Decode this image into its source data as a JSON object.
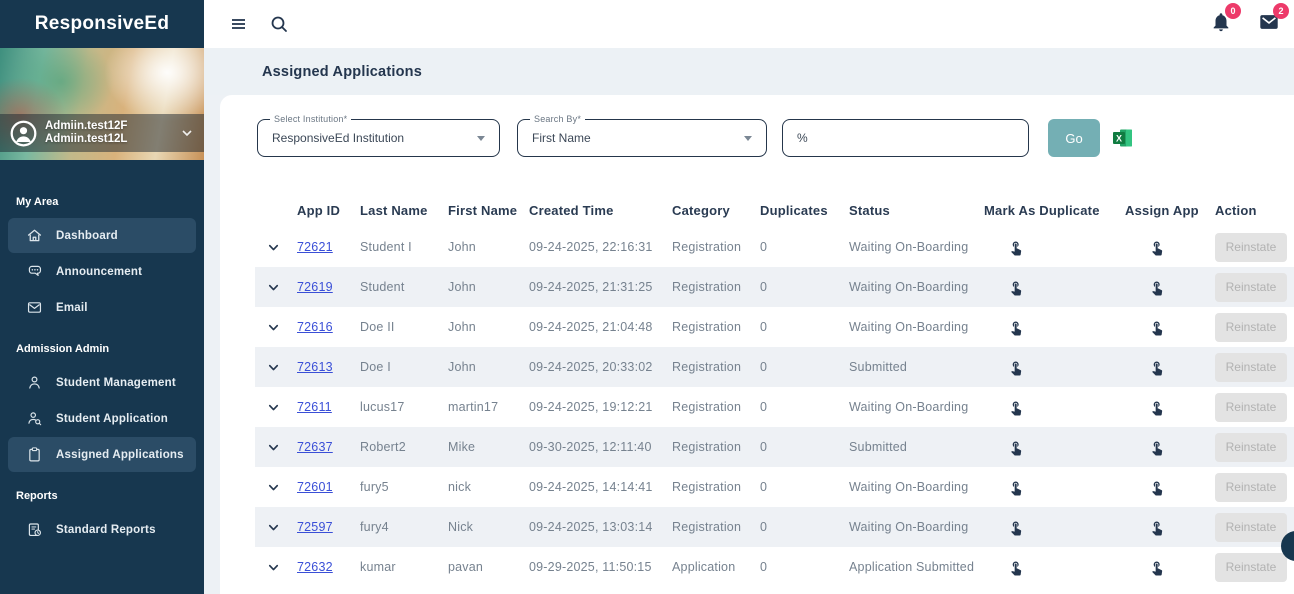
{
  "app": {
    "logo": "ResponsiveEd"
  },
  "profile": {
    "line1": "Admiin.test12F",
    "line2": "Admiin.test12L"
  },
  "topbar": {
    "notifications_badge": "0",
    "messages_badge": "2"
  },
  "page": {
    "title": "Assigned Applications"
  },
  "sidebar": {
    "sections": [
      {
        "label": "My Area",
        "items": [
          {
            "label": "Dashboard",
            "selected": true
          },
          {
            "label": "Announcement",
            "selected": false
          },
          {
            "label": "Email",
            "selected": false
          }
        ]
      },
      {
        "label": "Admission Admin",
        "items": [
          {
            "label": "Student Management",
            "selected": false
          },
          {
            "label": "Student Application",
            "selected": false
          },
          {
            "label": "Assigned Applications",
            "selected": true
          }
        ]
      },
      {
        "label": "Reports",
        "items": [
          {
            "label": "Standard Reports",
            "selected": false
          }
        ]
      }
    ]
  },
  "filters": {
    "institution": {
      "label": "Select Institution*",
      "value": "ResponsiveEd Institution"
    },
    "search_by": {
      "label": "Search By*",
      "value": "First Name"
    },
    "search_value": "%",
    "go_label": "Go"
  },
  "table": {
    "columns": [
      "App ID",
      "Last Name",
      "First Name",
      "Created Time",
      "Category",
      "Duplicates",
      "Status",
      "Mark As Duplicate",
      "Assign App",
      "Action"
    ],
    "action_label": "Reinstate",
    "rows": [
      {
        "app_id": "72621",
        "last_name": "Student I",
        "first_name": "John",
        "created_time": "09-24-2025, 22:16:31",
        "category": "Registration",
        "duplicates": "0",
        "status": "Waiting On-Boarding"
      },
      {
        "app_id": "72619",
        "last_name": "Student",
        "first_name": "John",
        "created_time": "09-24-2025, 21:31:25",
        "category": "Registration",
        "duplicates": "0",
        "status": "Waiting On-Boarding"
      },
      {
        "app_id": "72616",
        "last_name": "Doe II",
        "first_name": "John",
        "created_time": "09-24-2025, 21:04:48",
        "category": "Registration",
        "duplicates": "0",
        "status": "Waiting On-Boarding"
      },
      {
        "app_id": "72613",
        "last_name": "Doe I",
        "first_name": "John",
        "created_time": "09-24-2025, 20:33:02",
        "category": "Registration",
        "duplicates": "0",
        "status": "Submitted"
      },
      {
        "app_id": "72611",
        "last_name": "lucus17",
        "first_name": "martin17",
        "created_time": "09-24-2025, 19:12:21",
        "category": "Registration",
        "duplicates": "0",
        "status": "Waiting On-Boarding"
      },
      {
        "app_id": "72637",
        "last_name": "Robert2",
        "first_name": "Mike",
        "created_time": "09-30-2025, 12:11:40",
        "category": "Registration",
        "duplicates": "0",
        "status": "Submitted"
      },
      {
        "app_id": "72601",
        "last_name": "fury5",
        "first_name": "nick",
        "created_time": "09-24-2025, 14:14:41",
        "category": "Registration",
        "duplicates": "0",
        "status": "Waiting On-Boarding"
      },
      {
        "app_id": "72597",
        "last_name": "fury4",
        "first_name": "Nick",
        "created_time": "09-24-2025, 13:03:14",
        "category": "Registration",
        "duplicates": "0",
        "status": "Waiting On-Boarding"
      },
      {
        "app_id": "72632",
        "last_name": "kumar",
        "first_name": "pavan",
        "created_time": "09-29-2025, 11:50:15",
        "category": "Application",
        "duplicates": "0",
        "status": "Application Submitted"
      }
    ]
  },
  "colors": {
    "sidebar_navy": "#17374F",
    "selected_item": "#2B4C66",
    "badge_pink": "#ED3A6A",
    "go_teal": "#74AFB4",
    "link_blue": "#3A4FD7",
    "excel_green": "#107C41",
    "row_alt": "#EEF1F5",
    "header_text": "#2A3B52",
    "cell_text": "#76828F"
  },
  "icons": {
    "topbar": [
      "menu-icon",
      "search-icon",
      "notifications-bell-icon",
      "messages-mail-icon"
    ],
    "row_actions": [
      "touch-app-icon"
    ],
    "export": "excel-export-icon"
  }
}
